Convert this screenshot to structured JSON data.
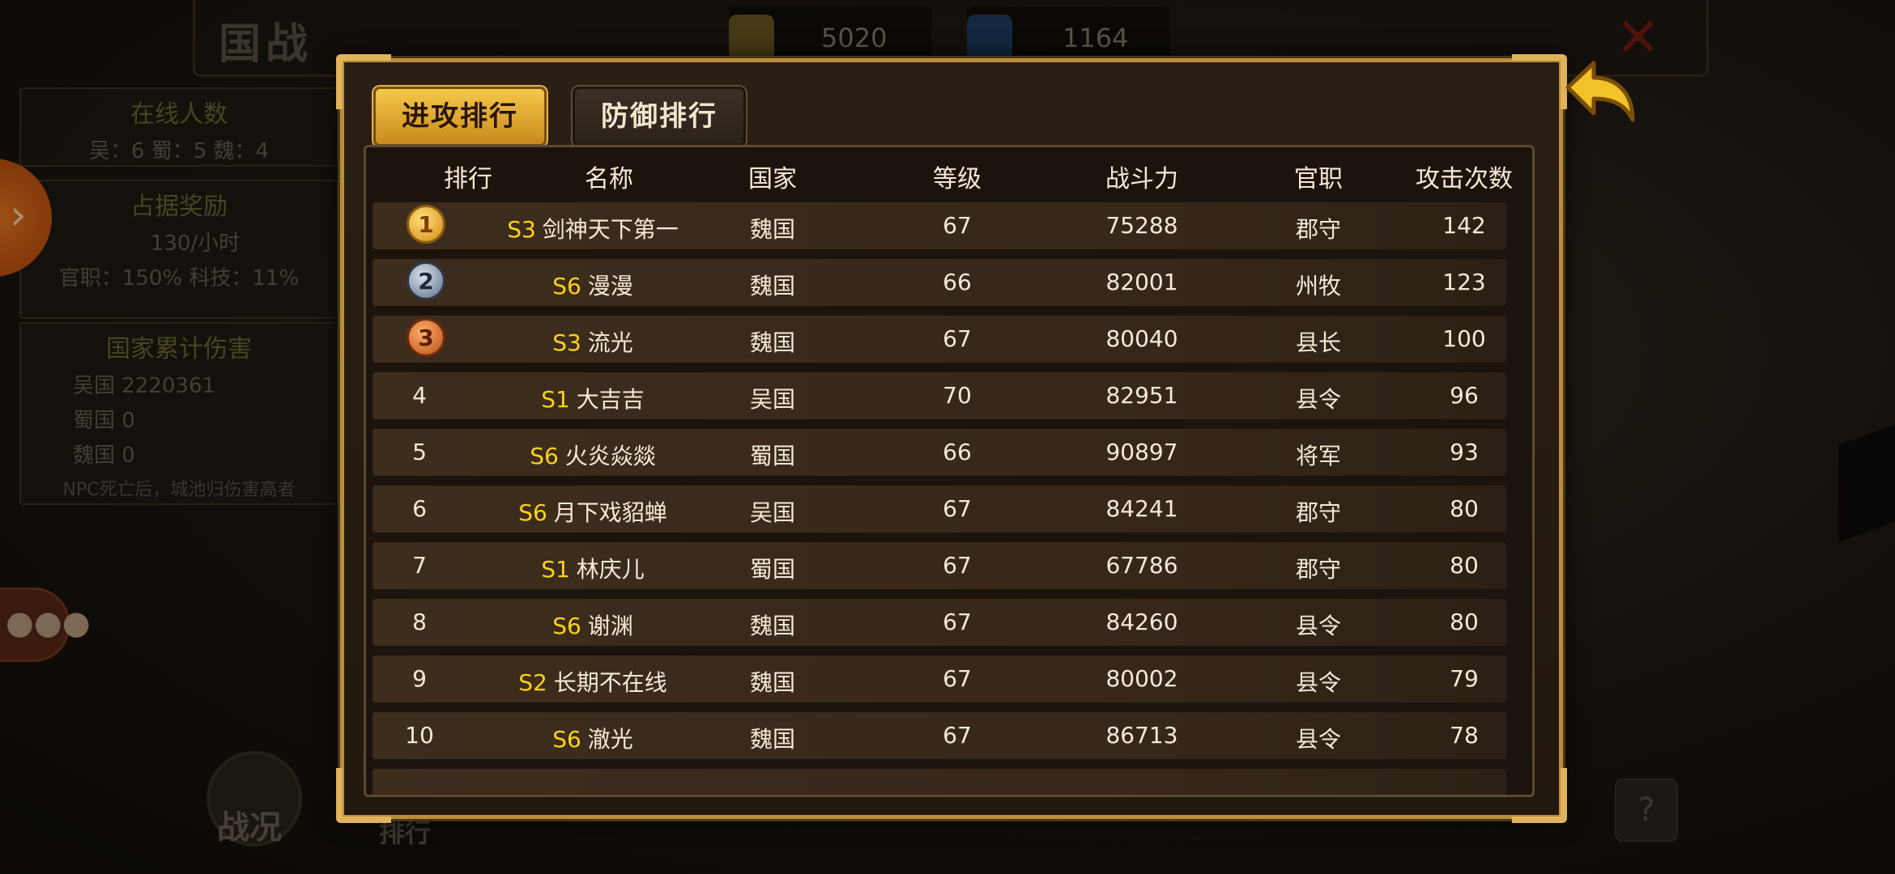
{
  "background": {
    "title": "国战",
    "resources": [
      {
        "icon": "scroll-icon",
        "value": "5020"
      },
      {
        "icon": "gem-icon",
        "value": "1164"
      }
    ],
    "close_symbol": "✕",
    "online": {
      "title": "在线人数",
      "text": "吴：6 蜀：5 魏：4"
    },
    "reward": {
      "title": "占据奖励",
      "rate": "130/小时",
      "bonus": "官职：150% 科技：11%"
    },
    "damage": {
      "title": "国家累计伤害",
      "lines": [
        "吴国 2220361",
        "蜀国 0",
        "魏国 0"
      ],
      "note": "NPC死亡后，城池归伤害高者"
    },
    "war_label": "战况",
    "rank_label": "排行",
    "help": "?"
  },
  "modal": {
    "tabs": [
      {
        "label": "进攻排行",
        "active": true
      },
      {
        "label": "防御排行",
        "active": false
      }
    ],
    "headers": [
      "排行",
      "名称",
      "国家",
      "等级",
      "战斗力",
      "官职",
      "攻击次数"
    ],
    "rows": [
      {
        "rank": "1",
        "prefix": "S3",
        "name": "剑神天下第一",
        "country": "魏国",
        "level": "67",
        "power": "75288",
        "title": "郡守",
        "attacks": "142"
      },
      {
        "rank": "2",
        "prefix": "S6",
        "name": "漫漫",
        "country": "魏国",
        "level": "66",
        "power": "82001",
        "title": "州牧",
        "attacks": "123"
      },
      {
        "rank": "3",
        "prefix": "S3",
        "name": "流光",
        "country": "魏国",
        "level": "67",
        "power": "80040",
        "title": "县长",
        "attacks": "100"
      },
      {
        "rank": "4",
        "prefix": "S1",
        "name": "大吉吉",
        "country": "吴国",
        "level": "70",
        "power": "82951",
        "title": "县令",
        "attacks": "96"
      },
      {
        "rank": "5",
        "prefix": "S6",
        "name": "火炎焱燚",
        "country": "蜀国",
        "level": "66",
        "power": "90897",
        "title": "将军",
        "attacks": "93"
      },
      {
        "rank": "6",
        "prefix": "S6",
        "name": "月下戏貂蝉",
        "country": "吴国",
        "level": "67",
        "power": "84241",
        "title": "郡守",
        "attacks": "80"
      },
      {
        "rank": "7",
        "prefix": "S1",
        "name": "林庆儿",
        "country": "蜀国",
        "level": "67",
        "power": "67786",
        "title": "郡守",
        "attacks": "80"
      },
      {
        "rank": "8",
        "prefix": "S6",
        "name": "谢渊",
        "country": "魏国",
        "level": "67",
        "power": "84260",
        "title": "县令",
        "attacks": "80"
      },
      {
        "rank": "9",
        "prefix": "S2",
        "name": "长期不在线",
        "country": "魏国",
        "level": "67",
        "power": "80002",
        "title": "县令",
        "attacks": "79"
      },
      {
        "rank": "10",
        "prefix": "S6",
        "name": "澈光",
        "country": "魏国",
        "level": "67",
        "power": "86713",
        "title": "县令",
        "attacks": "78"
      }
    ]
  },
  "colors": {
    "server_prefix": "#ffd21a",
    "frame_gold": "#b98d3c",
    "text": "#f4ead6"
  }
}
